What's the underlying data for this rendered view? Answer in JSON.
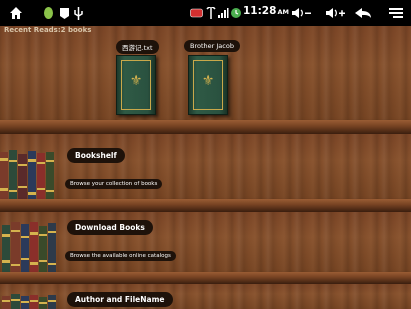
{
  "status_bar": {
    "left_icons": [
      "home-icon",
      "android-icon",
      "notification-icon",
      "usb-icon"
    ],
    "right_icons": [
      "battery-icon",
      "signal-icon",
      "wifi-icon",
      "alarm-icon"
    ],
    "time": "11:28",
    "ampm": "AM",
    "controls": [
      "volume-down-icon",
      "volume-up-icon",
      "back-icon",
      "menu-icon"
    ]
  },
  "recent": {
    "title": "Recent Reads:2 books",
    "books": [
      {
        "title": "西游记.txt"
      },
      {
        "title": "Brother Jacob"
      }
    ]
  },
  "categories": [
    {
      "label": "Bookshelf",
      "description": "Browse your collection of books"
    },
    {
      "label": "Download Books",
      "description": "Browse the available online catalogs"
    },
    {
      "label": "Author and FileName",
      "description": ""
    }
  ],
  "colors": {
    "wood": "#7a4526",
    "label_bg": "#1e120a",
    "book_green": "#2a5240",
    "gold": "#c9a84a"
  }
}
